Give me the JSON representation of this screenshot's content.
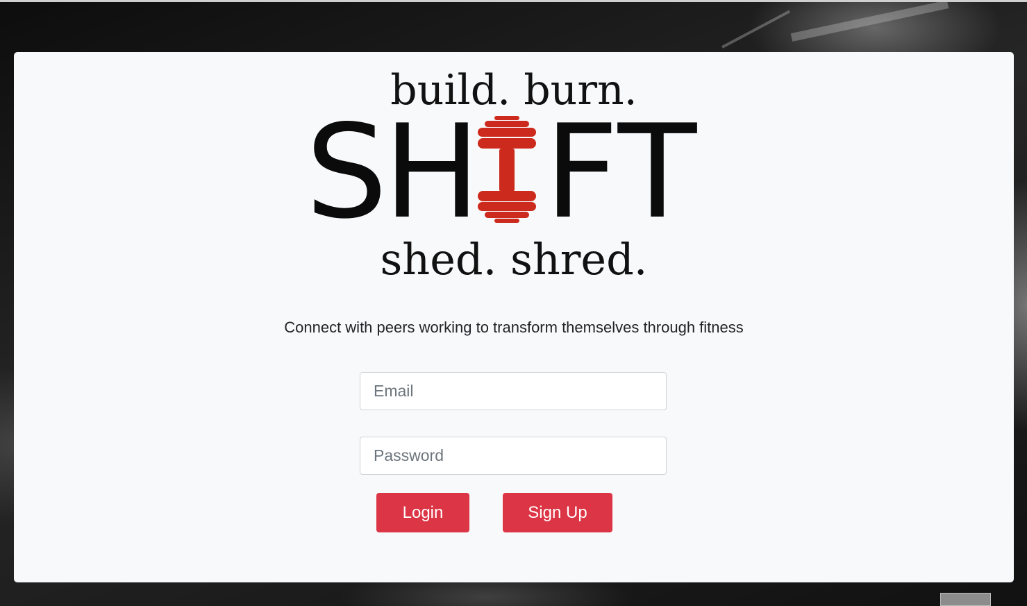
{
  "logo": {
    "tagline_top": "build. burn.",
    "brand_start": "SH",
    "brand_end": "FT",
    "tagline_bottom": "shed. shred.",
    "accent_color": "#cc2a1c",
    "icon": "dumbbell-icon"
  },
  "subtitle": "Connect with peers working to transform themselves through fitness",
  "form": {
    "email_placeholder": "Email",
    "password_placeholder": "Password",
    "login_label": "Login",
    "signup_label": "Sign Up"
  },
  "colors": {
    "button": "#dc3545",
    "card": "#f8f9fa"
  }
}
